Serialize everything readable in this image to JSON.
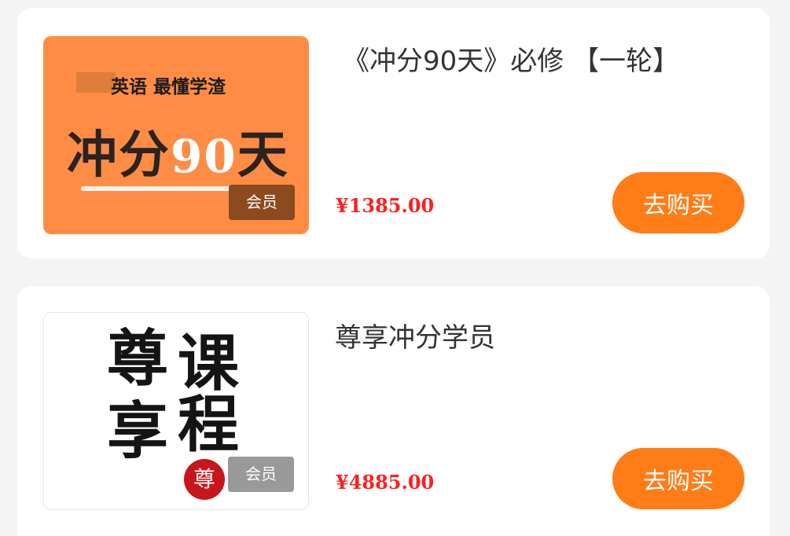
{
  "products": [
    {
      "title": "《冲分90天》必修 【一轮】",
      "price": "¥1385.00",
      "badge": "会员",
      "buy_label": "去购买",
      "thumb": {
        "subtitle": "英语  最懂学渣",
        "main_a": "冲分",
        "main_num": "90",
        "main_b": "天"
      }
    },
    {
      "title": "尊享冲分学员",
      "price": "¥4885.00",
      "badge": "会员",
      "buy_label": "去购买",
      "thumb": {
        "char1": "尊",
        "char2": "课",
        "char3": "享",
        "char4": "程",
        "seal": "尊"
      }
    }
  ],
  "colors": {
    "background": "#f4f4f4",
    "card": "#ffffff",
    "accent": "#ff7c16",
    "price": "#ff1f1f",
    "thumb1_bg": "#ff8c45"
  }
}
